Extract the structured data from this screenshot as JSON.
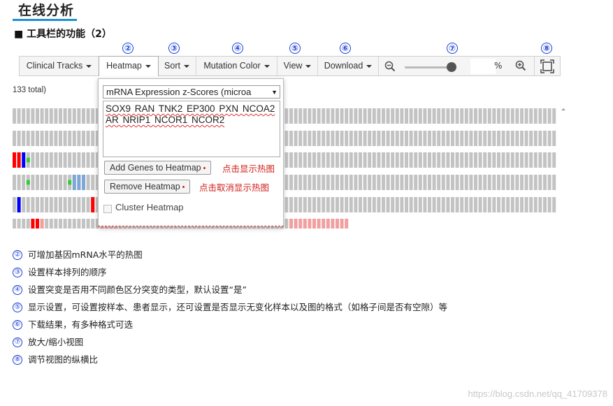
{
  "title": "在线分析",
  "subheading": "■ 工具栏的功能（2）",
  "toolbar_numbers": [
    {
      "num": "②",
      "target": "heatmap"
    },
    {
      "num": "③",
      "target": "sort"
    },
    {
      "num": "④",
      "target": "mutation_color"
    },
    {
      "num": "⑤",
      "target": "view"
    },
    {
      "num": "⑥",
      "target": "download"
    },
    {
      "num": "⑦",
      "target": "zoom"
    },
    {
      "num": "⑧",
      "target": "fit"
    }
  ],
  "toolbar": {
    "clinical_tracks": "Clinical Tracks",
    "heatmap": "Heatmap",
    "sort": "Sort",
    "mutation_color": "Mutation Color",
    "view": "View",
    "download": "Download",
    "zoom_value": "",
    "percent": "%"
  },
  "total_text": "133 total)",
  "heatmap_dropdown": {
    "profile_select": "mRNA Expression z-Scores (microa",
    "genes_text": "SOX9 RAN TNK2 EP300 PXN NCOA2 AR NRIP1 NCOR1 NCOR2",
    "add_button": "Add Genes to Heatmap",
    "add_note": "点击显示热图",
    "remove_button": "Remove Heatmap",
    "remove_note": "点击取消显示热图",
    "cluster_label": "Cluster Heatmap"
  },
  "notes": [
    {
      "num": "②",
      "text": "可增加基因mRNA水平的热图"
    },
    {
      "num": "③",
      "text": "设置样本排列的顺序"
    },
    {
      "num": "④",
      "text": "设置突变是否用不同颜色区分突变的类型，默认设置“是”"
    },
    {
      "num": "⑤",
      "text": "显示设置，可设置按样本、患者显示，还可设置是否显示无变化样本以及图的格式（如格子间是否有空隙）等"
    },
    {
      "num": "⑥",
      "text": "下载结果，有多种格式可选"
    },
    {
      "num": "⑦",
      "text": "放大/缩小视图"
    },
    {
      "num": "⑧",
      "text": "调节视图的纵横比"
    }
  ],
  "watermark": "https://blog.csdn.net/qq_41709378",
  "colors": {
    "accent_blue": "#1e90d6",
    "number_blue": "#1a3fd6",
    "note_red": "#d0211b",
    "cell_gray": "#c3c3c3",
    "amp_red": "#ff0000",
    "del_blue": "#0000ff",
    "mut_green": "#33cc33",
    "mrna_pink": "#f0a0a0",
    "mrna_blue": "#7ea7d8"
  }
}
